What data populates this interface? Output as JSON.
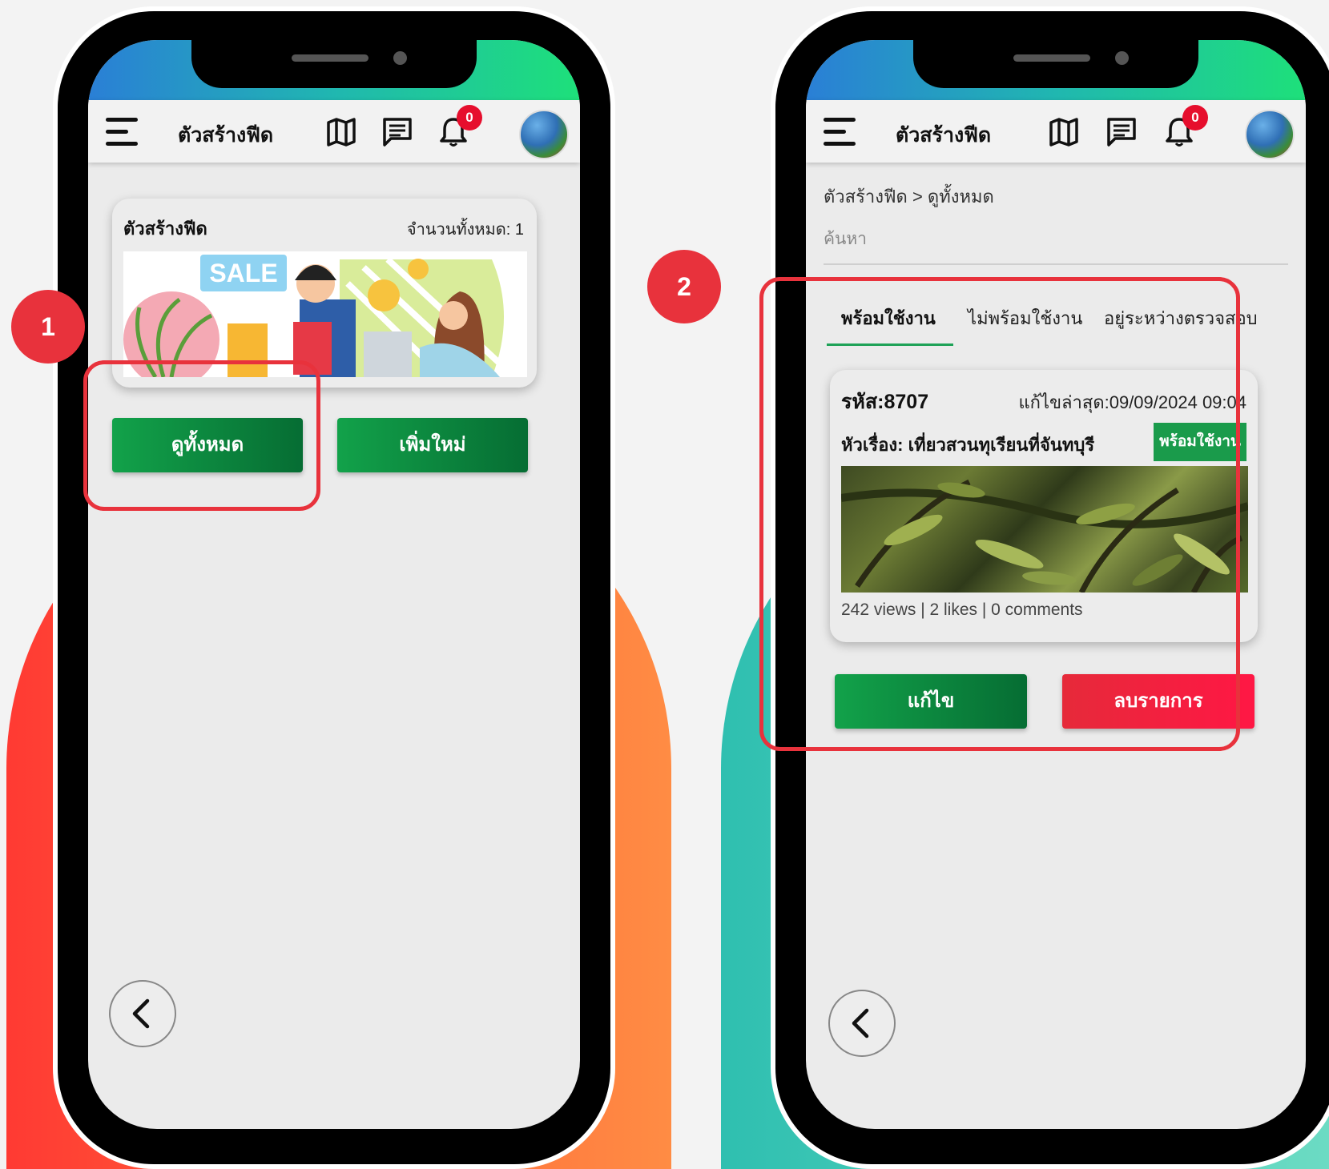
{
  "colors": {
    "accent_green": "#1a9b4b",
    "accent_red": "#e8323c",
    "notification_badge": "#e60e2d"
  },
  "steps": [
    {
      "number": "1"
    },
    {
      "number": "2"
    }
  ],
  "app": {
    "title": "ตัวสร้างฟีด",
    "notification_count": "0",
    "icons": [
      "menu-icon",
      "map-icon",
      "chat-icon",
      "bell-icon"
    ]
  },
  "screen1": {
    "card": {
      "title": "ตัวสร้างฟีด",
      "count_label": "จำนวนทั้งหมด: 1",
      "banner_text": "SALE"
    },
    "buttons": {
      "view_all": "ดูทั้งหมด",
      "add_new": "เพิ่มใหม่"
    }
  },
  "screen2": {
    "breadcrumb": "ตัวสร้างฟีด > ดูทั้งหมด",
    "search_placeholder": "ค้นหา",
    "tabs": [
      {
        "label": "พร้อมใช้งาน",
        "active": true
      },
      {
        "label": "ไม่พร้อมใช้งาน",
        "active": false
      },
      {
        "label": "อยู่ระหว่างตรวจสอบ",
        "active": false
      }
    ],
    "item": {
      "code": "รหัส:8707",
      "updated": "แก้ไขล่าสุด:09/09/2024 09:04",
      "title": "หัวเรื่อง: เที่ยวสวนทุเรียนที่จันทบุรี",
      "status": "พร้อมใช้งาน",
      "stats": "242 views | 2 likes | 0 comments"
    },
    "buttons": {
      "edit": "แก้ไข",
      "delete": "ลบรายการ"
    }
  }
}
